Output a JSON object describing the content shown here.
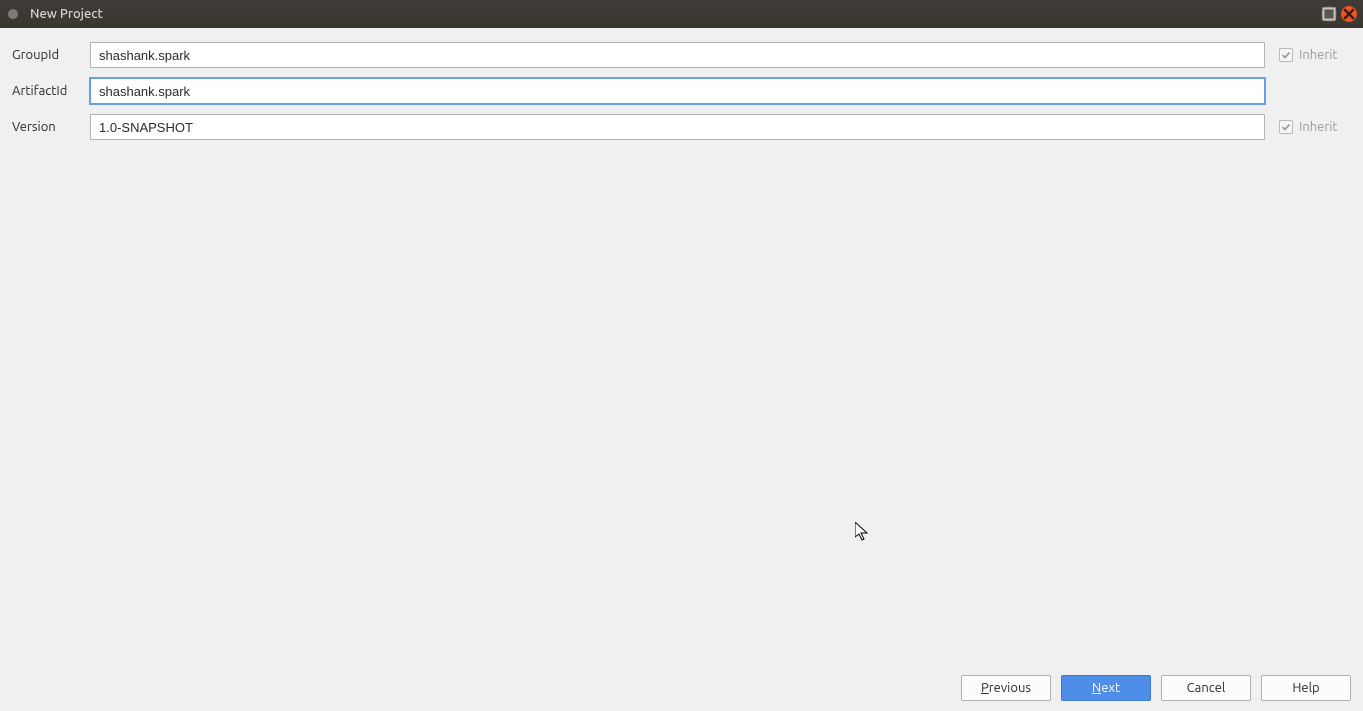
{
  "window": {
    "title": "New Project"
  },
  "form": {
    "groupId": {
      "label": "GroupId",
      "value": "shashank.spark"
    },
    "artifactId": {
      "label": "ArtifactId",
      "value": "shashank.spark"
    },
    "version": {
      "label": "Version",
      "value": "1.0-SNAPSHOT"
    },
    "inherit_label": "Inherit"
  },
  "buttons": {
    "previous": "Previous",
    "next": "Next",
    "cancel": "Cancel",
    "help": "Help"
  }
}
